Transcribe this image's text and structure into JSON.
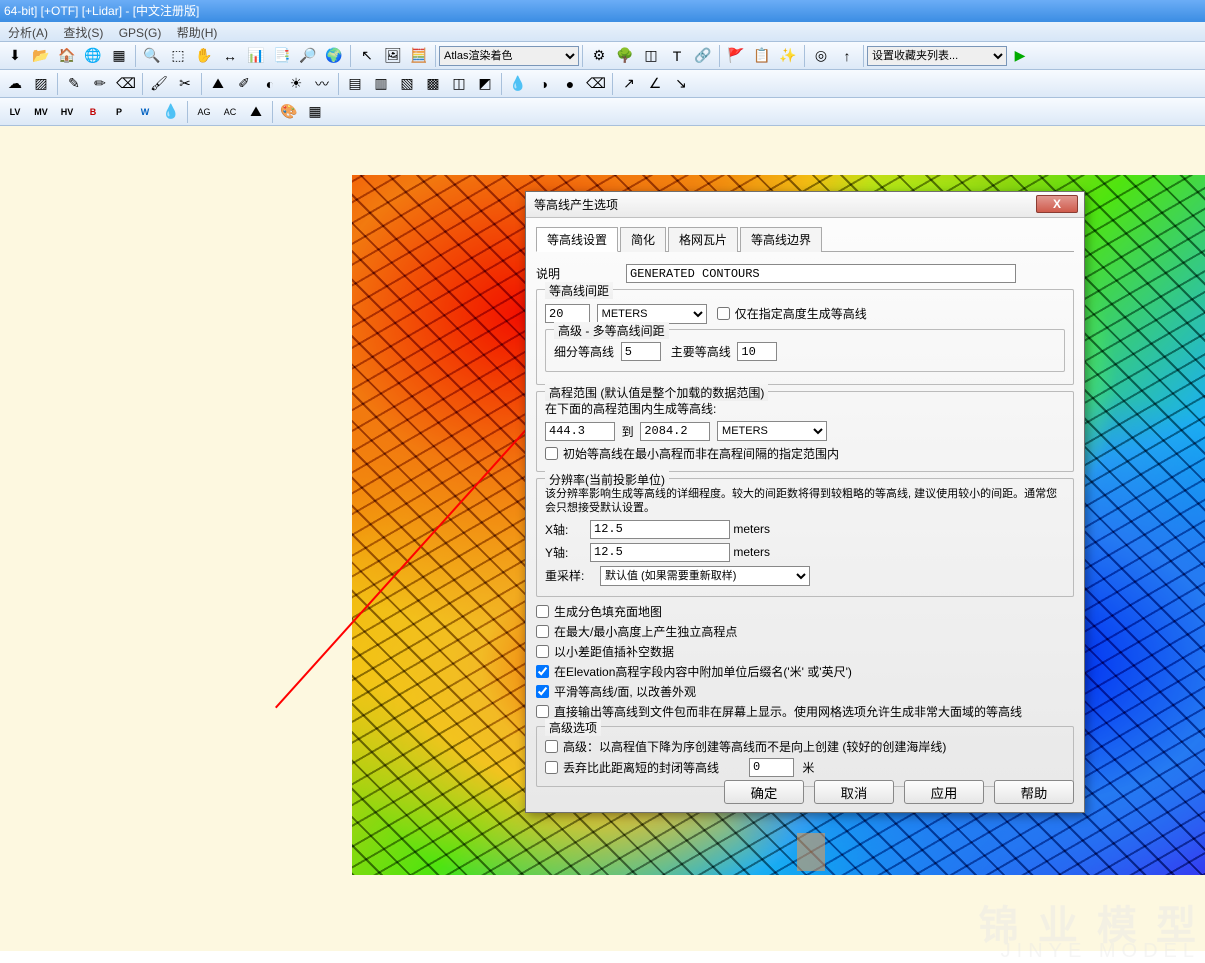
{
  "title": "64-bit] [+OTF] [+Lidar] - [中文注册版]",
  "menu": {
    "analysis": "分析(A)",
    "search": "查找(S)",
    "gps": "GPS(G)",
    "help": "帮助(H)"
  },
  "toolbar": {
    "render": "Atlas渲染着色",
    "favorites": "设置收藏夹列表..."
  },
  "tb3_labels": [
    "LV",
    "MV",
    "HV",
    "B",
    "P",
    "W"
  ],
  "dialog": {
    "title": "等高线产生选项",
    "close": "X",
    "tabs": [
      "等高线设置",
      "简化",
      "格网瓦片",
      "等高线边界"
    ],
    "desc_lbl": "说明",
    "desc_val": "GENERATED CONTOURS",
    "interval": {
      "title": "等高线间距",
      "val": "20",
      "unit": "METERS",
      "only_at": "仅在指定高度生成等高线",
      "adv_title": "高级 - 多等高线间距",
      "minor_lbl": "细分等高线",
      "minor": "5",
      "major_lbl": "主要等高线",
      "major": "10"
    },
    "range": {
      "title": "高程范围 (默认值是整个加载的数据范围)",
      "desc": "在下面的高程范围内生成等高线:",
      "from": "444.3",
      "to_lbl": "到",
      "to": "2084.2",
      "unit": "METERS",
      "start_min": "初始等高线在最小高程而非在高程间隔的指定范围内"
    },
    "res": {
      "title": "分辨率(当前投影单位)",
      "desc": "该分辨率影响生成等高线的详细程度。较大的间距数将得到较粗略的等高线, 建议使用较小的间距。通常您会只想接受默认设置。",
      "x_lbl": "X轴:",
      "x": "12.5",
      "x_unit": "meters",
      "y_lbl": "Y轴:",
      "y": "12.5",
      "y_unit": "meters",
      "resample_lbl": "重采样:",
      "resample": "默认值 (如果需要重新取样)"
    },
    "opts": {
      "o1": "生成分色填充面地图",
      "o2": "在最大/最小高度上产生独立高程点",
      "o3": "以小差距值插补空数据",
      "o4": "在Elevation高程字段内容中附加单位后缀名('米' 或'英尺')",
      "o5": "平滑等高线/面, 以改善外观",
      "o6": "直接输出等高线到文件包而非在屏幕上显示。使用网格选项允许生成非常大面域的等高线"
    },
    "adv": {
      "title": "高级选项",
      "a1": "高级：以高程值下降为序创建等高线而不是向上创建 (较好的创建海岸线)",
      "a2": "丢弃比此距离短的封闭等高线",
      "a2_val": "0",
      "a2_unit": "米"
    },
    "buttons": {
      "ok": "确定",
      "cancel": "取消",
      "apply": "应用",
      "help": "帮助"
    }
  },
  "watermark": "锦 业 模 型",
  "watermark2": "JINYE  MODEL"
}
